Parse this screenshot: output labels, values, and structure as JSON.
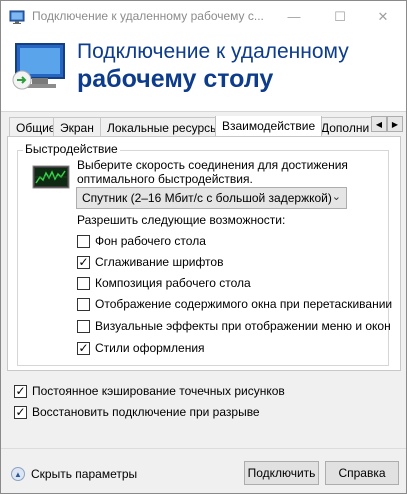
{
  "window": {
    "title": "Подключение к удаленному рабочему с...",
    "minimize_icon": "minimize-icon",
    "maximize_icon": "maximize-icon",
    "close_icon": "close-icon"
  },
  "banner": {
    "line1": "Подключение к удаленному",
    "line2": "рабочему столу"
  },
  "tabs": [
    "Общие",
    "Экран",
    "Локальные ресурсы",
    "Взаимодействие",
    "Дополни"
  ],
  "active_tab": "Взаимодействие",
  "performance": {
    "group_label": "Быстродействие",
    "description": "Выберите скорость соединения для достижения оптимального быстродействия.",
    "speed_selected": "Спутник (2–16 Мбит/с с большой задержкой)",
    "allow_label": "Разрешить следующие возможности:",
    "options": [
      {
        "label": "Фон рабочего стола",
        "checked": false
      },
      {
        "label": "Сглаживание шрифтов",
        "checked": true
      },
      {
        "label": "Композиция рабочего стола",
        "checked": false
      },
      {
        "label": "Отображение содержимого окна при перетаскивании",
        "checked": false
      },
      {
        "label": "Визуальные эффекты при отображении меню и окон",
        "checked": false
      },
      {
        "label": "Стили оформления",
        "checked": true
      }
    ]
  },
  "bottom_options": [
    {
      "label": "Постоянное кэширование точечных рисунков",
      "checked": true
    },
    {
      "label": "Восстановить подключение при разрыве",
      "checked": true
    }
  ],
  "footer": {
    "show_params": "Скрыть параметры",
    "connect": "Подключить",
    "help": "Справка"
  },
  "colors": {
    "accent": "#0d3c8c",
    "window_bg": "#f0f0f0"
  }
}
